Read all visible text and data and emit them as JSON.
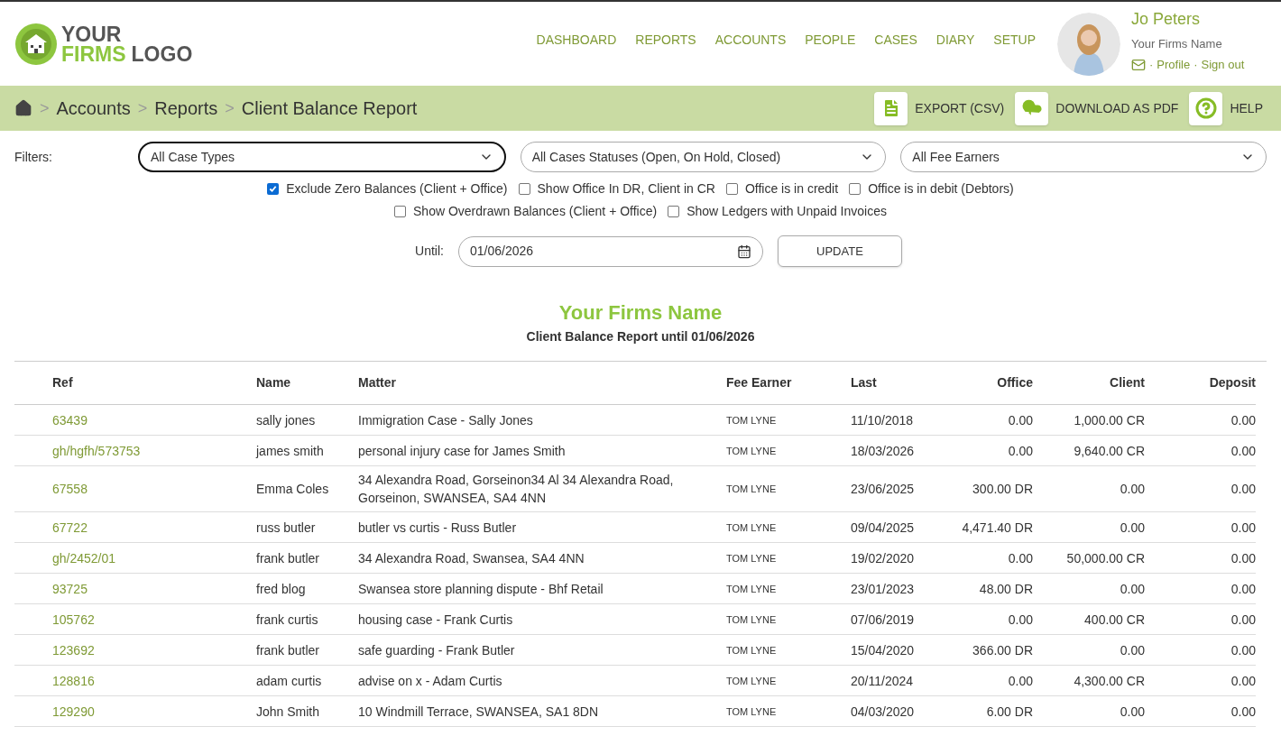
{
  "logo": {
    "line1": "YOUR",
    "line2a": "FIRMS",
    "line2b": "LOGO"
  },
  "nav": [
    {
      "label": "DASHBOARD"
    },
    {
      "label": "REPORTS"
    },
    {
      "label": "ACCOUNTS"
    },
    {
      "label": "PEOPLE"
    },
    {
      "label": "CASES"
    },
    {
      "label": "DIARY"
    },
    {
      "label": "SETUP"
    }
  ],
  "user": {
    "name": "Jo Peters",
    "firm": "Your Firms Name",
    "sep1": "·",
    "profile": "Profile",
    "sep2": "·",
    "signout": "Sign out"
  },
  "breadcrumb": [
    {
      "label": "Accounts"
    },
    {
      "label": "Reports"
    },
    {
      "label": "Client Balance Report"
    }
  ],
  "breadcrumb_sep": ">",
  "actions": [
    {
      "kind": "file",
      "label": "EXPORT (CSV)"
    },
    {
      "kind": "download",
      "label": "DOWNLOAD AS PDF"
    },
    {
      "kind": "help",
      "label": "HELP"
    }
  ],
  "filters": {
    "label": "Filters:",
    "selects": [
      {
        "value": "All Case Types",
        "focused": true
      },
      {
        "value": "All Cases Statuses (Open, On Hold, Closed)",
        "focused": false
      },
      {
        "value": "All Fee Earners",
        "focused": false
      }
    ],
    "checkbox_rows": [
      [
        {
          "label": "Exclude Zero Balances (Client + Office)",
          "checked": true
        },
        {
          "label": "Show Office In DR, Client in CR",
          "checked": false
        },
        {
          "label": "Office is in credit",
          "checked": false
        },
        {
          "label": "Office is in debit (Debtors)",
          "checked": false
        }
      ],
      [
        {
          "label": "Show Overdrawn Balances (Client + Office)",
          "checked": false
        },
        {
          "label": "Show Ledgers with Unpaid Invoices",
          "checked": false
        }
      ]
    ],
    "until_label": "Until:",
    "until_value": "01/06/2026",
    "update": "UPDATE"
  },
  "report": {
    "title": "Your Firms Name",
    "subtitle": "Client Balance Report until 01/06/2026"
  },
  "table": {
    "columns": [
      "Ref",
      "Name",
      "Matter",
      "Fee Earner",
      "Last",
      "Office",
      "Client",
      "Deposit"
    ],
    "rows": [
      [
        "63439",
        "sally jones",
        "Immigration Case - Sally Jones",
        "TOM LYNE",
        "11/10/2018",
        "0.00",
        "1,000.00 CR",
        "0.00"
      ],
      [
        "gh/hgfh/573753",
        "james smith",
        "personal injury case for James Smith",
        "TOM LYNE",
        "18/03/2026",
        "0.00",
        "9,640.00 CR",
        "0.00"
      ],
      [
        "67558",
        "Emma Coles",
        "34 Alexandra Road, Gorseinon34 Al 34 Alexandra Road, Gorseinon, SWANSEA, SA4 4NN",
        "TOM LYNE",
        "23/06/2025",
        "300.00 DR",
        "0.00",
        "0.00"
      ],
      [
        "67722",
        "russ butler",
        "butler vs curtis - Russ Butler",
        "TOM LYNE",
        "09/04/2025",
        "4,471.40 DR",
        "0.00",
        "0.00"
      ],
      [
        "gh/2452/01",
        "frank butler",
        "34 Alexandra Road, Swansea, SA4 4NN",
        "TOM LYNE",
        "19/02/2020",
        "0.00",
        "50,000.00 CR",
        "0.00"
      ],
      [
        "93725",
        "fred blog",
        "Swansea store planning dispute - Bhf Retail",
        "TOM LYNE",
        "23/01/2023",
        "48.00 DR",
        "0.00",
        "0.00"
      ],
      [
        "105762",
        "frank curtis",
        "housing case - Frank Curtis",
        "TOM LYNE",
        "07/06/2019",
        "0.00",
        "400.00 CR",
        "0.00"
      ],
      [
        "123692",
        "frank butler",
        "safe guarding - Frank Butler",
        "TOM LYNE",
        "15/04/2020",
        "366.00 DR",
        "0.00",
        "0.00"
      ],
      [
        "128816",
        "adam curtis",
        "advise on x - Adam Curtis",
        "TOM LYNE",
        "20/11/2024",
        "0.00",
        "4,300.00 CR",
        "0.00"
      ],
      [
        "129290",
        "John Smith",
        "10 Windmill Terrace, SWANSEA, SA1 8DN",
        "TOM LYNE",
        "04/03/2020",
        "6.00 DR",
        "0.00",
        "0.00"
      ]
    ]
  }
}
